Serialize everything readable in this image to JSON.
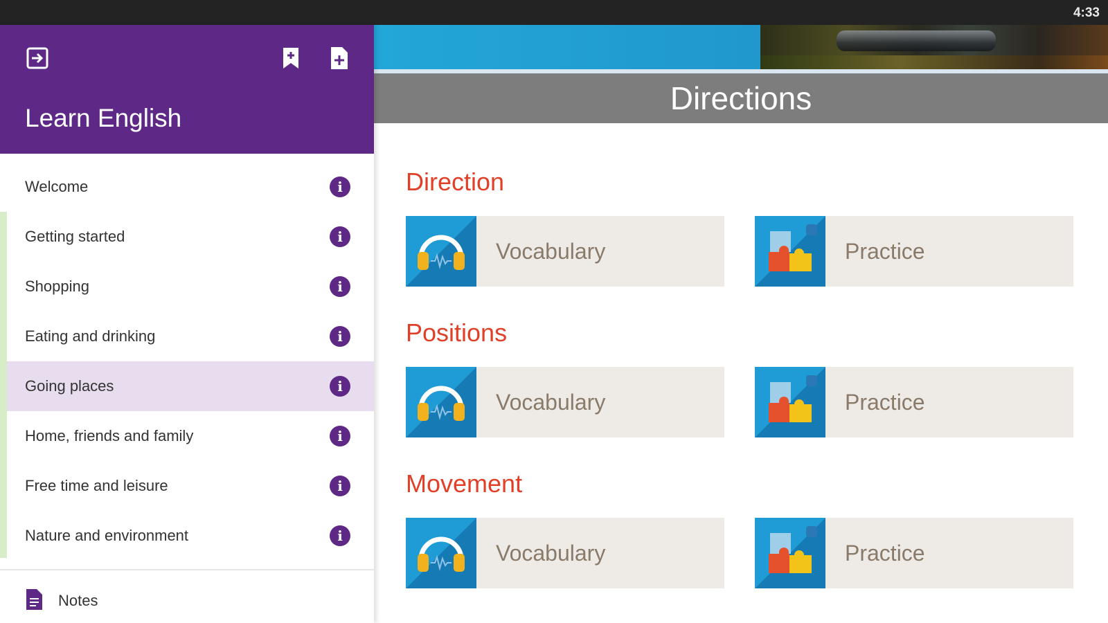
{
  "status_bar": {
    "time": "4:33"
  },
  "drawer": {
    "app_title": "Learn English",
    "items": [
      {
        "label": "Welcome"
      },
      {
        "label": "Getting started"
      },
      {
        "label": "Shopping"
      },
      {
        "label": "Eating and drinking"
      },
      {
        "label": "Going places",
        "active": true
      },
      {
        "label": "Home, friends and family"
      },
      {
        "label": "Free time and leisure"
      },
      {
        "label": "Nature and environment"
      }
    ],
    "notes_label": "Notes",
    "info_glyph": "i",
    "accent_color": "#5e2886"
  },
  "main": {
    "page_title": "Directions",
    "sections": [
      {
        "title": "Direction",
        "cards": [
          {
            "label": "Vocabulary",
            "icon": "headphones-icon"
          },
          {
            "label": "Practice",
            "icon": "puzzle-icon"
          }
        ]
      },
      {
        "title": "Positions",
        "cards": [
          {
            "label": "Vocabulary",
            "icon": "headphones-icon"
          },
          {
            "label": "Practice",
            "icon": "puzzle-icon"
          }
        ]
      },
      {
        "title": "Movement",
        "cards": [
          {
            "label": "Vocabulary",
            "icon": "headphones-icon"
          },
          {
            "label": "Practice",
            "icon": "puzzle-icon"
          }
        ]
      }
    ],
    "section_title_color": "#e04028"
  }
}
